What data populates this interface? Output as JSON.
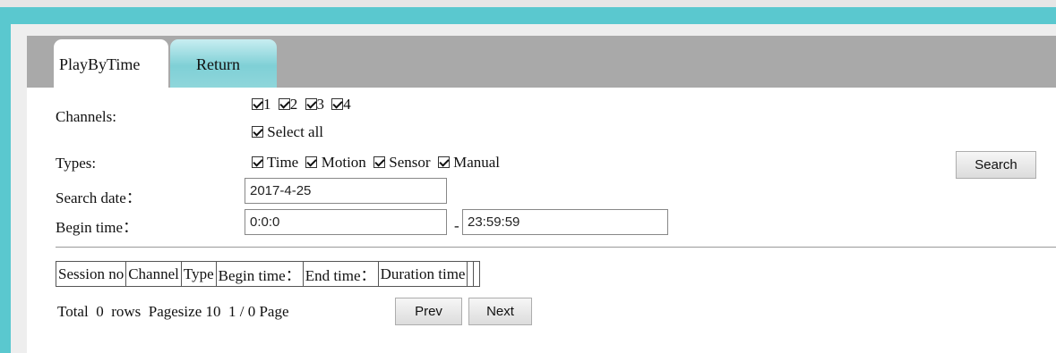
{
  "tabs": [
    {
      "label": "PlayByTime",
      "active": true
    },
    {
      "label": "Return",
      "active": false
    }
  ],
  "form": {
    "channels_label": "Channels:",
    "channels": [
      "1",
      "2",
      "3",
      "4"
    ],
    "select_all_label": "Select all",
    "types_label": "Types:",
    "types": [
      "Time",
      "Motion",
      "Sensor",
      "Manual"
    ],
    "search_date_label": "Search date：",
    "search_date_value": "2017-4-25",
    "begin_time_label": "Begin time：",
    "begin_time_value": "0:0:0",
    "range_separator": "-",
    "end_time_value": "23:59:59",
    "search_button": "Search"
  },
  "table": {
    "headers": [
      "Session no",
      "Channel",
      "Type",
      "Begin time：",
      "End time：",
      "Duration time",
      "",
      ""
    ]
  },
  "pager": {
    "total_prefix": "Total",
    "total_rows": "0",
    "rows_label": "rows",
    "pagesize_label": "Pagesize",
    "pagesize": "10",
    "page_status": "1 / 0 Page",
    "prev_button": "Prev",
    "next_button": "Next"
  },
  "colors": {
    "accent": "#5ac8cf",
    "tab_strip": "#a9a9a9",
    "background": "#ffffff"
  }
}
